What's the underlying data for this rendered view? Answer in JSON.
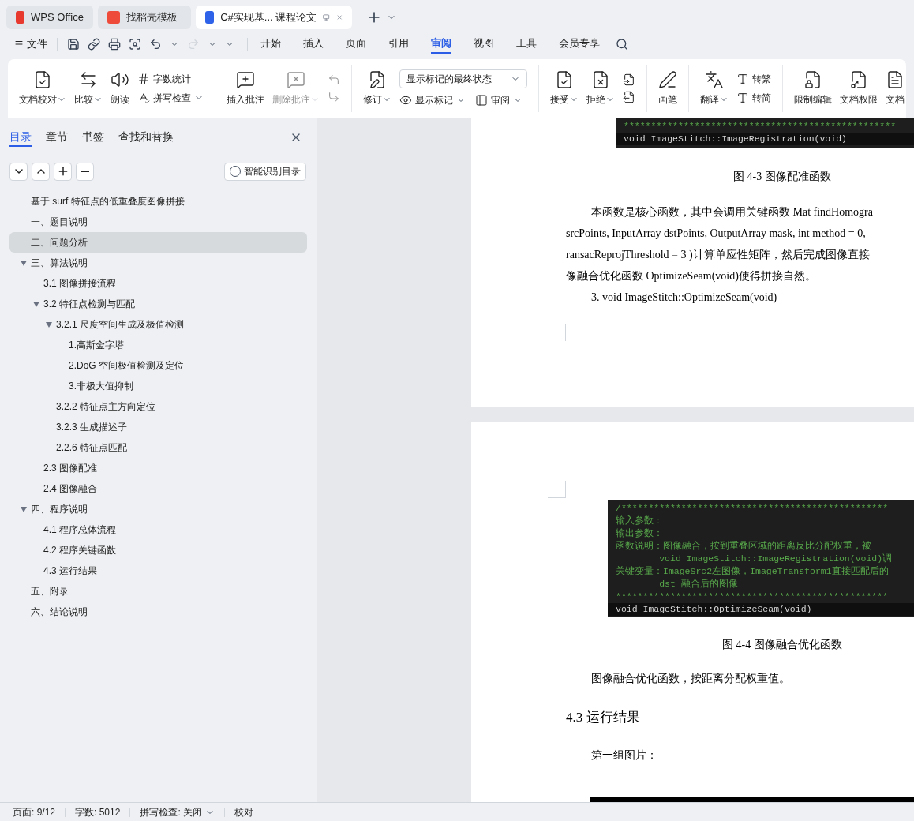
{
  "title_tabs": [
    {
      "label": "WPS Office",
      "selected": false
    },
    {
      "label": "找稻壳模板",
      "selected": false
    },
    {
      "label": "C#实现基... 课程论文",
      "selected": true
    }
  ],
  "file_menu": "文件",
  "menu_tabs": [
    {
      "label": "开始",
      "selected": false
    },
    {
      "label": "插入",
      "selected": false
    },
    {
      "label": "页面",
      "selected": false
    },
    {
      "label": "引用",
      "selected": false
    },
    {
      "label": "审阅",
      "selected": true
    },
    {
      "label": "视图",
      "selected": false
    },
    {
      "label": "工具",
      "selected": false
    },
    {
      "label": "会员专享",
      "selected": false
    }
  ],
  "ribbon": [
    {
      "columns": [
        {
          "rows": [
            [
              {
                "kind": "large",
                "label": "文档校对",
                "menu": true,
                "disabled": false
              }
            ]
          ]
        },
        {
          "rows": [
            [
              {
                "kind": "large",
                "label": "比较",
                "menu": true,
                "disabled": false
              }
            ]
          ]
        },
        {
          "rows": [
            [
              {
                "kind": "large",
                "label": "朗读",
                "menu": false,
                "disabled": false
              }
            ]
          ]
        },
        {
          "rows": [
            [
              {
                "kind": "small",
                "label": "字数统计",
                "menu": false,
                "disabled": false
              }
            ],
            [
              {
                "kind": "small",
                "label": "拼写检查",
                "menu": true,
                "disabled": false
              }
            ]
          ]
        }
      ]
    },
    {
      "columns": [
        {
          "rows": [
            [
              {
                "kind": "large",
                "label": "插入批注",
                "menu": false,
                "disabled": false
              }
            ]
          ]
        },
        {
          "rows": [
            [
              {
                "kind": "large",
                "label": "删除批注",
                "menu": true,
                "disabled": true
              }
            ]
          ]
        },
        {
          "rows": [
            [
              {
                "kind": "icon",
                "disabled": true
              }
            ],
            [
              {
                "kind": "icon",
                "disabled": true
              }
            ]
          ]
        }
      ]
    },
    {
      "columns": [
        {
          "rows": [
            [
              {
                "kind": "large",
                "label": "修订",
                "menu": true,
                "disabled": false
              }
            ]
          ]
        },
        {
          "rows": [
            [
              {
                "kind": "select",
                "label": "显示标记的最终状态",
                "disabled": false
              }
            ],
            [
              {
                "kind": "small",
                "label": "显示标记",
                "menu": true,
                "disabled": false
              },
              {
                "kind": "small",
                "label": "审阅",
                "menu": true,
                "disabled": false
              }
            ]
          ]
        }
      ]
    },
    {
      "columns": [
        {
          "rows": [
            [
              {
                "kind": "large",
                "label": "接受",
                "menu": true,
                "disabled": false
              }
            ]
          ]
        },
        {
          "rows": [
            [
              {
                "kind": "large",
                "label": "拒绝",
                "menu": true,
                "disabled": false
              }
            ]
          ]
        },
        {
          "rows": [
            [
              {
                "kind": "icon",
                "disabled": false
              }
            ],
            [
              {
                "kind": "icon",
                "disabled": false
              }
            ]
          ]
        }
      ]
    },
    {
      "columns": [
        {
          "rows": [
            [
              {
                "kind": "large",
                "label": "画笔",
                "menu": false,
                "disabled": false
              }
            ]
          ]
        }
      ]
    },
    {
      "columns": [
        {
          "rows": [
            [
              {
                "kind": "large",
                "label": "翻译",
                "menu": true,
                "disabled": false
              }
            ]
          ]
        },
        {
          "rows": [
            [
              {
                "kind": "small",
                "label": "转繁",
                "menu": false,
                "disabled": false
              }
            ],
            [
              {
                "kind": "small",
                "label": "转简",
                "menu": false,
                "disabled": false
              }
            ]
          ]
        }
      ]
    },
    {
      "columns": [
        {
          "rows": [
            [
              {
                "kind": "large",
                "label": "限制编辑",
                "menu": false,
                "disabled": false
              }
            ]
          ]
        },
        {
          "rows": [
            [
              {
                "kind": "large",
                "label": "文档权限",
                "menu": false,
                "disabled": false
              }
            ]
          ]
        },
        {
          "rows": [
            [
              {
                "kind": "large",
                "label": "文档",
                "menu": false,
                "disabled": false
              }
            ]
          ]
        }
      ]
    }
  ],
  "nav_pane": {
    "tabs": [
      {
        "label": "目录",
        "selected": true
      },
      {
        "label": "章节",
        "selected": false
      },
      {
        "label": "书签",
        "selected": false
      },
      {
        "label": "查找和替换",
        "selected": false
      }
    ],
    "smart_button": "智能识别目录",
    "toc": [
      {
        "label": "基于 surf 特征点的低重叠度图像拼接",
        "selected": false
      },
      {
        "label": "一、题目说明",
        "selected": false
      },
      {
        "label": "二、问题分析",
        "selected": true
      },
      {
        "label": "三、算法说明",
        "selected": false,
        "expanded": true,
        "children": [
          {
            "label": "3.1  图像拼接流程",
            "selected": false
          },
          {
            "label": "3.2  特征点检测与匹配",
            "selected": false,
            "expanded": true,
            "children": [
              {
                "label": "3.2.1  尺度空间生成及极值检测",
                "selected": false,
                "expanded": true,
                "children": [
                  {
                    "label": "1.高斯金字塔",
                    "selected": false
                  },
                  {
                    "label": "2.DoG 空间极值检测及定位",
                    "selected": false
                  },
                  {
                    "label": "3.非极大值抑制",
                    "selected": false
                  }
                ]
              },
              {
                "label": "3.2.2  特征点主方向定位",
                "selected": false
              },
              {
                "label": "3.2.3  生成描述子",
                "selected": false
              },
              {
                "label": "2.2.6  特征点匹配",
                "selected": false
              }
            ]
          },
          {
            "label": "2.3  图像配准",
            "selected": false
          },
          {
            "label": "2.4  图像融合",
            "selected": false
          }
        ]
      },
      {
        "label": "四、程序说明",
        "selected": false,
        "expanded": true,
        "children": [
          {
            "label": "4.1  程序总体流程",
            "selected": false
          },
          {
            "label": "4.2 程序关键函数",
            "selected": false
          },
          {
            "label": "4.3  运行结果",
            "selected": false
          }
        ]
      },
      {
        "label": "五、附录",
        "selected": false
      },
      {
        "label": "六、结论说明",
        "selected": false
      }
    ]
  },
  "page_1": {
    "code_lines": [
      "**************************************************",
      "void ImageStitch::ImageRegistration(void)"
    ],
    "caption": "图 4-3  图像配准函数",
    "paragraph_lines": [
      "本函数是核心函数，其中会调用关键函数  Mat findHomogra",
      "srcPoints, InputArray dstPoints, OutputArray mask, int method = 0,",
      "ransacReprojThreshold = 3 )计算单应性矩阵，然后完成图像直接",
      "像融合优化函数 OptimizeSeam(void)使得拼接自然。"
    ],
    "list_item": "3.    void ImageStitch::OptimizeSeam(void)"
  },
  "page_2": {
    "code_lines": [
      "/*************************************************",
      "输入参数：",
      "输出参数：",
      "函数说明：图像融合，按到重叠区域的距离反比分配权重，被",
      "        void ImageStitch::ImageRegistration(void)调",
      "关键变量：ImageSrc2左图像，ImageTransform1直接匹配后的",
      "        dst 融合后的图像",
      "**************************************************",
      "void ImageStitch::OptimizeSeam(void)"
    ],
    "caption": "图 4-4  图像融合优化函数",
    "paragraph": "图像融合优化函数，按距离分配权重值。",
    "heading": "4.3  运行结果",
    "paragraph_2": "第一组图片："
  },
  "status_bar": [
    {
      "label": "页面: 9/12",
      "menu": false
    },
    {
      "label": "字数: 5012",
      "menu": false
    },
    {
      "label": "拼写检查: 关闭",
      "menu": true
    },
    {
      "label": "校对",
      "menu": false
    }
  ]
}
